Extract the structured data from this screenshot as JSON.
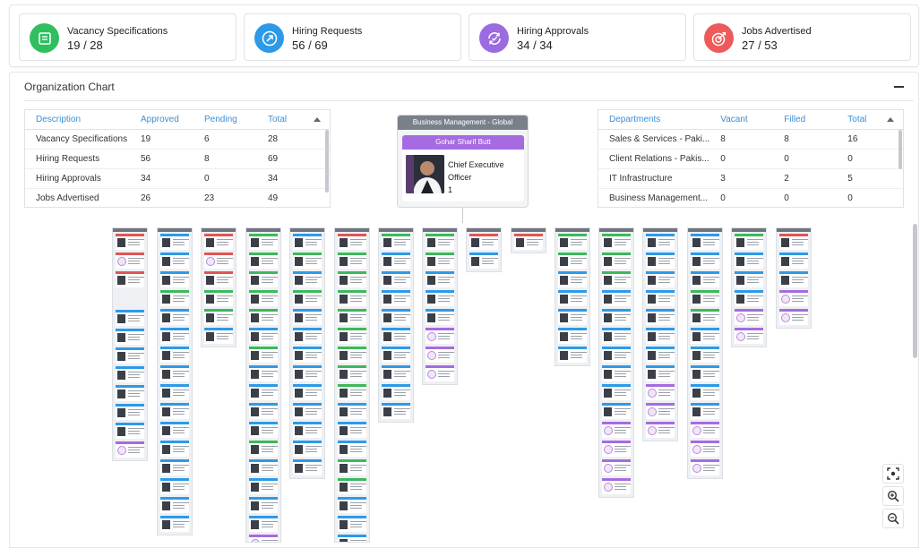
{
  "stats": [
    {
      "label": "Vacancy Specifications",
      "value": "19 / 28",
      "color": "#2fbf5f",
      "icon": "document-list-icon"
    },
    {
      "label": "Hiring Requests",
      "value": "56 / 69",
      "color": "#2d9ae8",
      "icon": "arrow-up-right-icon"
    },
    {
      "label": "Hiring Approvals",
      "value": "34 / 34",
      "color": "#9b6be0",
      "icon": "refresh-check-icon"
    },
    {
      "label": "Jobs Advertised",
      "value": "27 / 53",
      "color": "#ee5a5a",
      "icon": "target-icon"
    }
  ],
  "panel": {
    "title": "Organization Chart"
  },
  "left_table": {
    "headers": [
      "Description",
      "Approved",
      "Pending",
      "Total"
    ],
    "rows": [
      [
        "Vacancy Specifications",
        "19",
        "6",
        "28"
      ],
      [
        "Hiring Requests",
        "56",
        "8",
        "69"
      ],
      [
        "Hiring Approvals",
        "34",
        "0",
        "34"
      ],
      [
        "Jobs Advertised",
        "26",
        "23",
        "49"
      ]
    ]
  },
  "right_table": {
    "headers": [
      "Departments",
      "Vacant",
      "Filled",
      "Total"
    ],
    "rows": [
      [
        "Sales & Services - Paki...",
        "8",
        "8",
        "16"
      ],
      [
        "Client Relations - Pakis...",
        "0",
        "0",
        "0"
      ],
      [
        "IT Infrastructure",
        "3",
        "2",
        "5"
      ],
      [
        "Business Management...",
        "0",
        "0",
        "0"
      ]
    ]
  },
  "ceo": {
    "department": "Business Management - Global",
    "name": "Gohar Sharif Butt",
    "title_line1": "Chief Executive",
    "title_line2": "Officer",
    "count": "1"
  },
  "colors": {
    "accent_blue": "#3d8fd6",
    "purple": "#a66be0",
    "red": "#e05555",
    "green": "#3cb95a",
    "blue": "#2d9ae8"
  }
}
